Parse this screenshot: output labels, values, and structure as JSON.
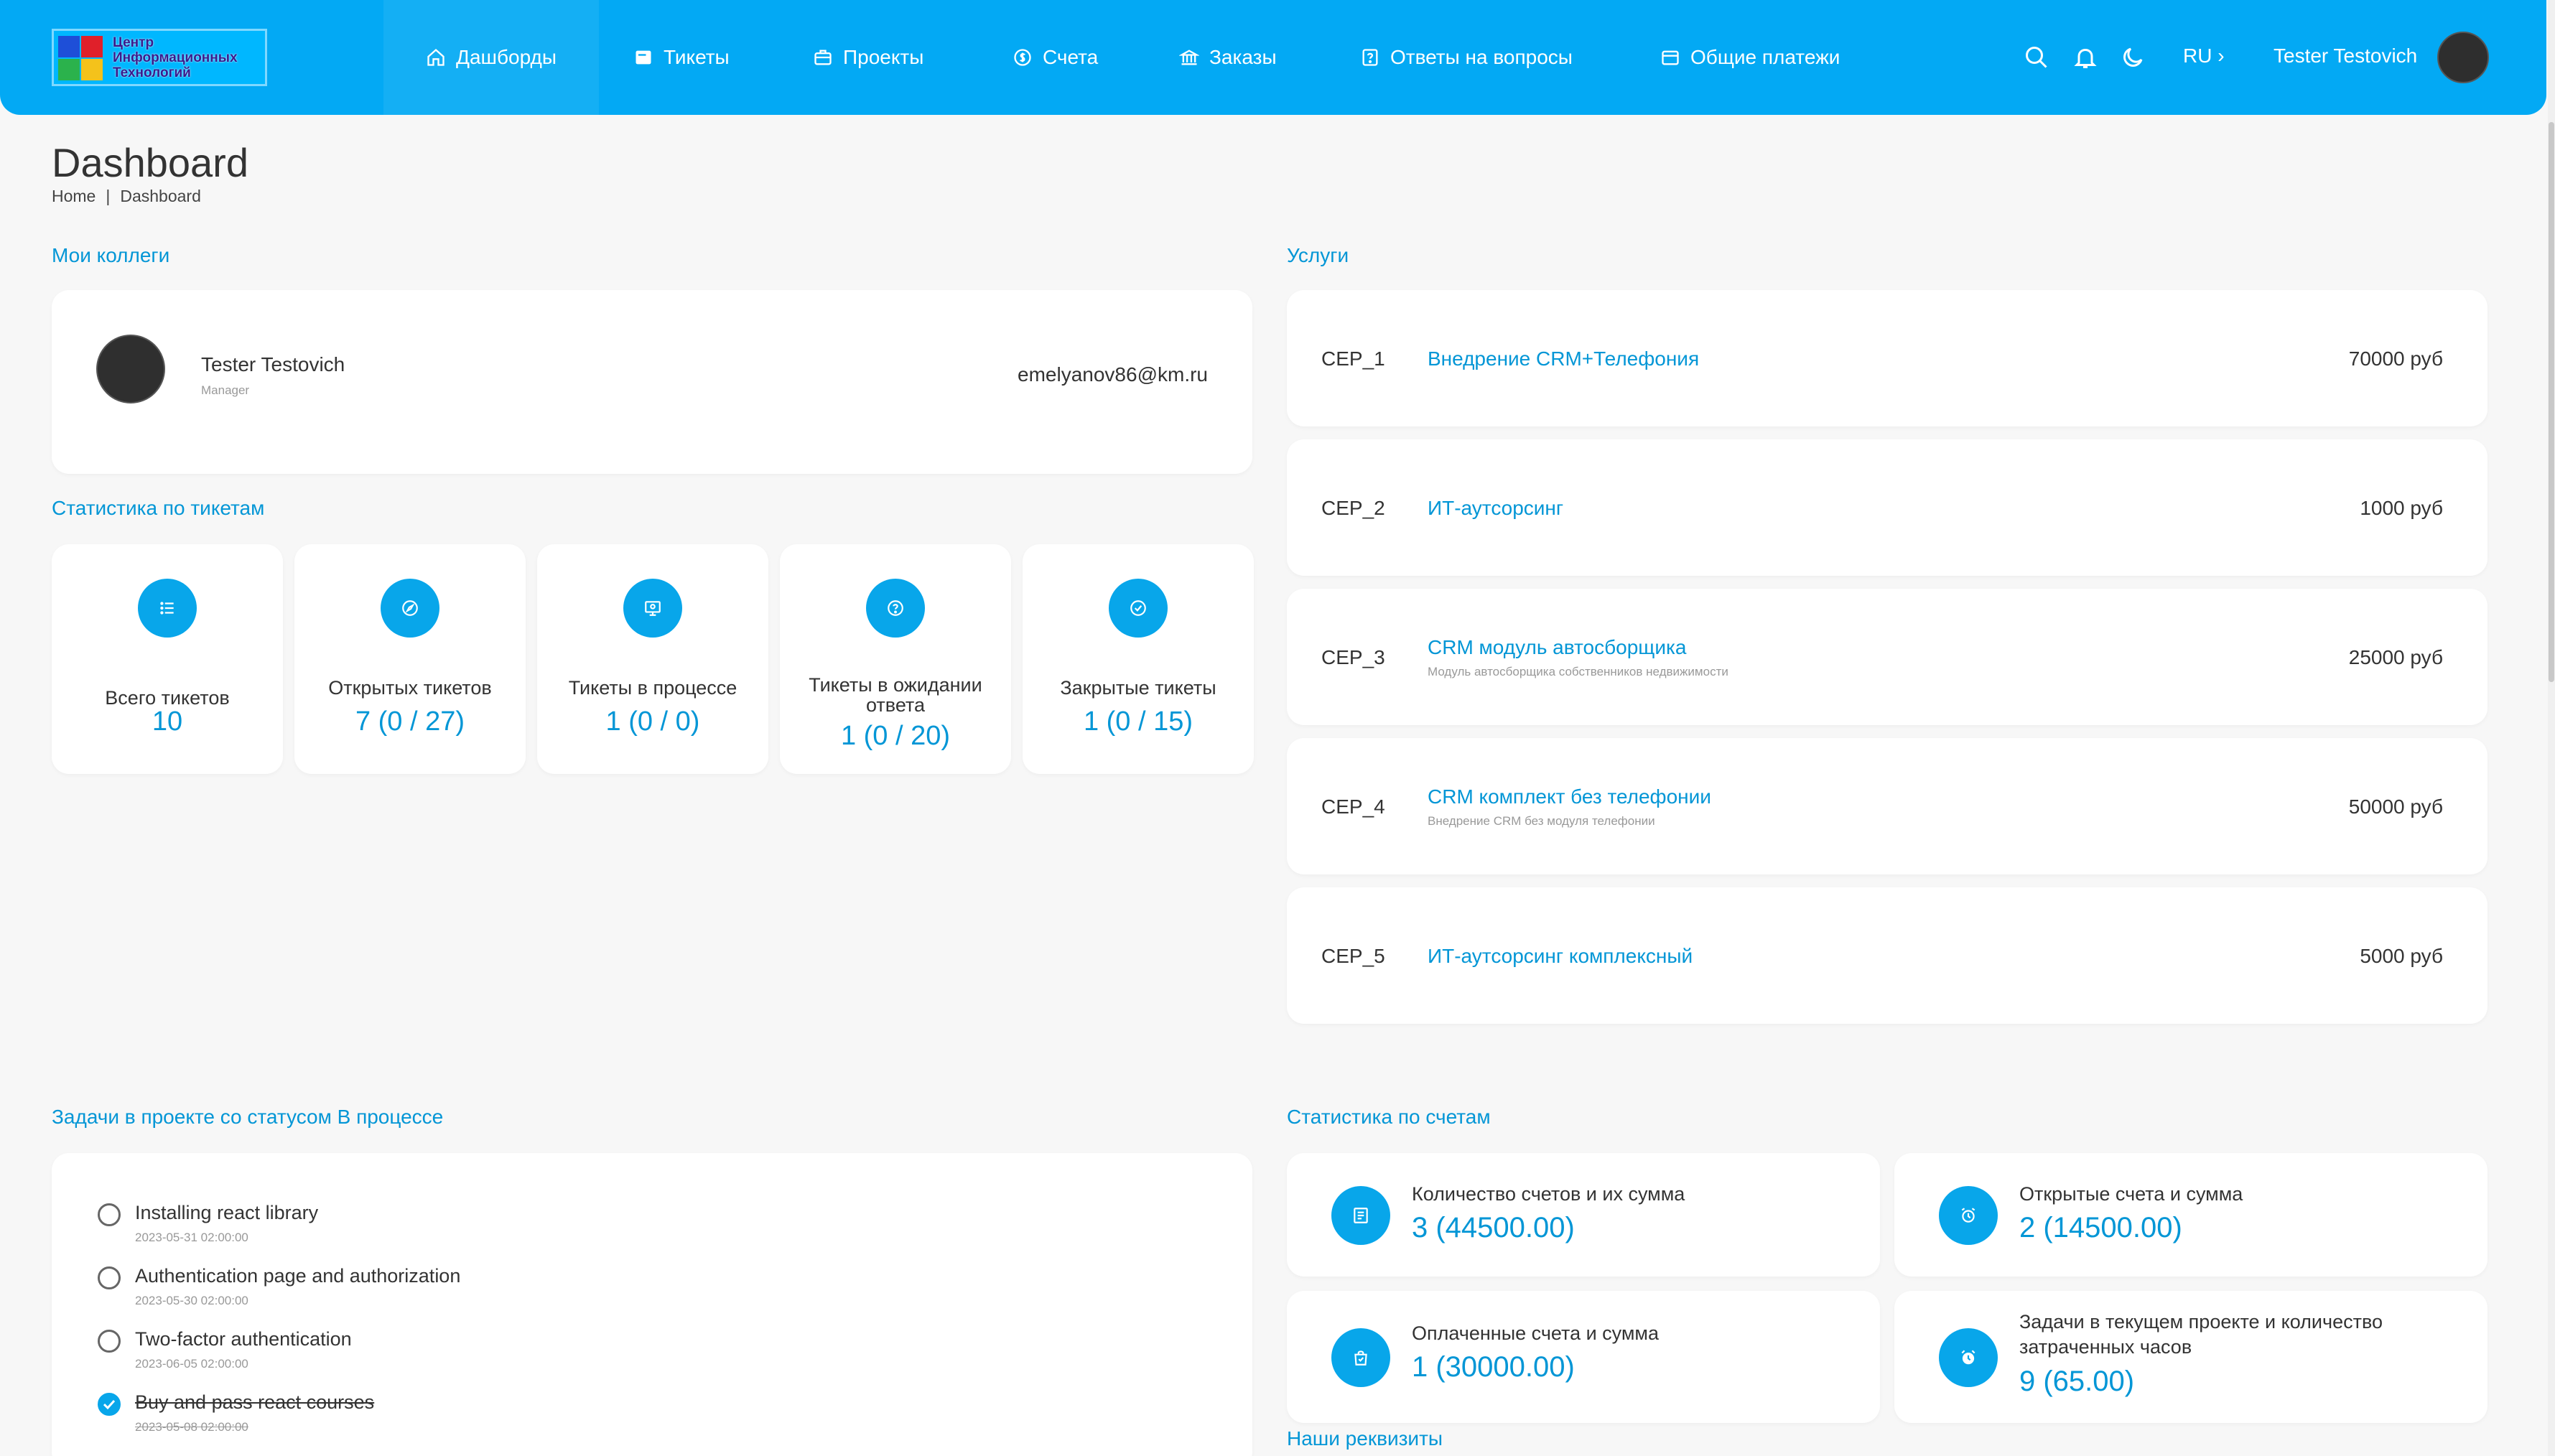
{
  "colors": {
    "accent": "#03a9f4",
    "link": "#0396d6",
    "background": "#f7f7f7"
  },
  "logo": {
    "line1": "Центр",
    "line2": "Информационных",
    "line3": "Технологий"
  },
  "nav": {
    "items": [
      {
        "label": "Дашборды",
        "icon": "home-icon"
      },
      {
        "label": "Тикеты",
        "icon": "ticket-icon"
      },
      {
        "label": "Проекты",
        "icon": "briefcase-icon"
      },
      {
        "label": "Счета",
        "icon": "dollar-icon"
      },
      {
        "label": "Заказы",
        "icon": "bank-icon"
      },
      {
        "label": "Ответы на вопросы",
        "icon": "question-icon"
      },
      {
        "label": "Общие платежи",
        "icon": "wallet-icon"
      }
    ],
    "language": "RU ›",
    "username": "Tester Testovich"
  },
  "page": {
    "title": "Dashboard",
    "breadcrumb": {
      "home": "Home",
      "separator": "|",
      "current": "Dashboard"
    }
  },
  "colleagues": {
    "title": "Мои коллеги",
    "person": {
      "name": "Tester Testovich",
      "role": "Manager",
      "email": "emelyanov86@km.ru"
    }
  },
  "ticket_stats": {
    "title": "Статистика по тикетам",
    "items": [
      {
        "label": "Всего тикетов",
        "value": "10",
        "icon": "list-icon"
      },
      {
        "label": "Открытых тикетов",
        "value": "7 (0 / 27)",
        "icon": "compass-icon"
      },
      {
        "label": "Тикеты в процессе",
        "value": "1 (0 / 0)",
        "icon": "monitor-icon"
      },
      {
        "label": "Тикеты в ожидании ответа",
        "value": "1 (0 / 20)",
        "icon": "help-circle-icon"
      },
      {
        "label": "Закрытые тикеты",
        "value": "1 (0 / 15)",
        "icon": "check-circle-icon"
      }
    ]
  },
  "services": {
    "title": "Услуги",
    "items": [
      {
        "code": "CEP_1",
        "name": "Внедрение CRM+Телефония",
        "description": "",
        "price": "70000 руб"
      },
      {
        "code": "CEP_2",
        "name": "ИТ-аутсорсинг",
        "description": "",
        "price": "1000 руб"
      },
      {
        "code": "CEP_3",
        "name": "CRM модуль автосборщика",
        "description": "Модуль автосборщика собственников недвижимости",
        "price": "25000 руб"
      },
      {
        "code": "CEP_4",
        "name": "CRM комплект без телефонии",
        "description": "Внедрение CRM без модуля телефонии",
        "price": "50000 руб"
      },
      {
        "code": "CEP_5",
        "name": "ИТ-аутсорсинг комплексный",
        "description": "",
        "price": "5000 руб"
      }
    ]
  },
  "tasks": {
    "title": "Задачи в проекте со статусом В процессе",
    "items": [
      {
        "title": "Installing react library",
        "date": "2023-05-31 02:00:00",
        "done": false
      },
      {
        "title": "Authentication page and authorization",
        "date": "2023-05-30 02:00:00",
        "done": false
      },
      {
        "title": "Two-factor authentication",
        "date": "2023-06-05 02:00:00",
        "done": false
      },
      {
        "title": "Buy and pass react courses",
        "date": "2023-05-08 02:00:00",
        "done": true
      }
    ]
  },
  "invoice_stats": {
    "title": "Статистика по счетам",
    "items": [
      {
        "label": "Количество счетов и их сумма",
        "value": "3 (44500.00)",
        "icon": "receipt-icon"
      },
      {
        "label": "Открытые счета и сумма",
        "value": "2 (14500.00)",
        "icon": "alarm-icon"
      },
      {
        "label": "Оплаченные счета и сумма",
        "value": "1 (30000.00)",
        "icon": "shopping-bag-icon"
      },
      {
        "label": "Задачи в текущем проекте и количество затраченных часов",
        "value": "9 (65.00)",
        "icon": "alarm-clock-icon"
      }
    ]
  },
  "requisites": {
    "title": "Наши реквизиты"
  }
}
